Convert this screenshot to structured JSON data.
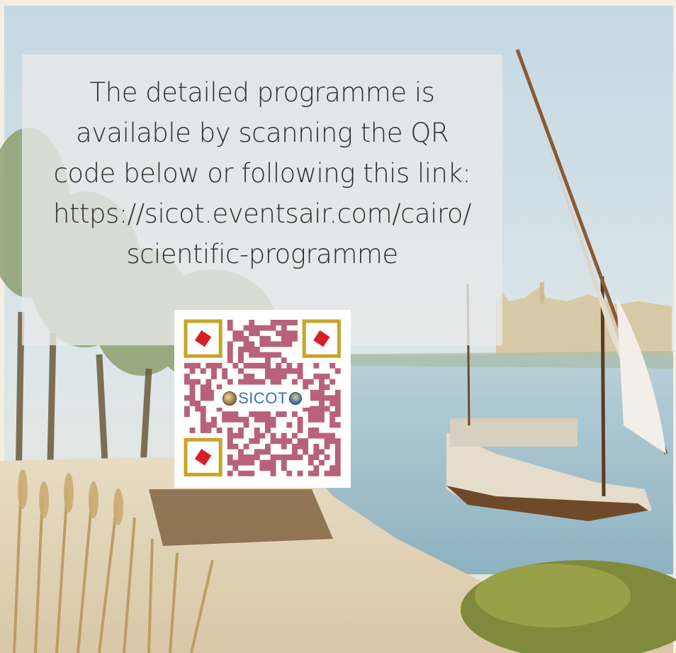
{
  "info_text": {
    "line1": "The detailed programme is",
    "line2": "available by scanning the QR",
    "line3": "code below or following this link:",
    "line4": "https://sicot.eventsair.com/cairo/",
    "line5": "scientific-programme"
  },
  "qr_logo": {
    "brand": "SICOT"
  },
  "colors": {
    "qr_module": "#b8617a",
    "qr_finder_frame": "#c9a428",
    "qr_finder_center": "#d81f27",
    "panel": "#e8e8e8"
  },
  "icons": [
    "sicot-emblem-icon",
    "globe-emblem-icon"
  ]
}
